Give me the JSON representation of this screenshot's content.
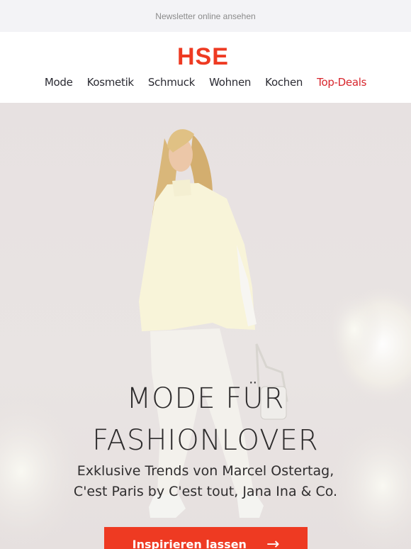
{
  "topbar": {
    "newsletter_link": "Newsletter online ansehen"
  },
  "header": {
    "logo_text": "HSE",
    "brand_color": "#ee3a22",
    "nav": [
      {
        "label": "Mode"
      },
      {
        "label": "Kosmetik"
      },
      {
        "label": "Schmuck"
      },
      {
        "label": "Wohnen"
      },
      {
        "label": "Kochen"
      },
      {
        "label": "Top-Deals",
        "color": "#d8262d"
      }
    ]
  },
  "hero": {
    "headline_line1": "MODE FÜR",
    "headline_line2": "FASHIONLOVER",
    "subline_line1": "Exklusive Trends von Marcel Ostertag,",
    "subline_line2": "C'est Paris by C'est tout, Jana Ina & Co.",
    "cta_label": "Inspirieren lassen",
    "cta_icon": "arrow-right-icon"
  }
}
